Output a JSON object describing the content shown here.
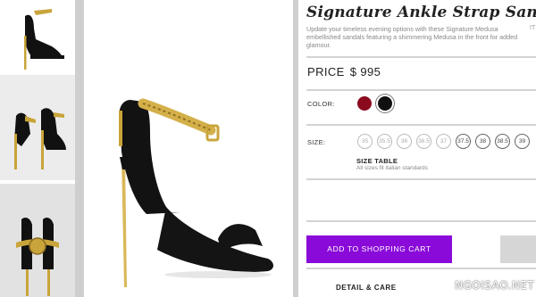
{
  "product": {
    "title": "Signature Ankle Strap Sandals",
    "description": "Update your timeless evening options with these Signature Medusa embellished sandals featuring a shimmering Medusa in the front for added glamour.",
    "description_overflow": "IT",
    "price_label": "PRICE",
    "price_value": "$ 995"
  },
  "color": {
    "label": "COLOR:",
    "swatches": [
      {
        "name": "burgundy",
        "hex": "#8b0a1e"
      },
      {
        "name": "black",
        "hex": "#111111",
        "selected": true
      }
    ]
  },
  "size": {
    "label": "SIZE:",
    "options": [
      {
        "value": "35",
        "available": false
      },
      {
        "value": "35.5",
        "available": false
      },
      {
        "value": "36",
        "available": false
      },
      {
        "value": "36.5",
        "available": false
      },
      {
        "value": "37",
        "available": false
      },
      {
        "value": "37.5",
        "available": true
      },
      {
        "value": "38",
        "available": true
      },
      {
        "value": "38.5",
        "available": true
      },
      {
        "value": "39",
        "available": true
      }
    ],
    "table_label": "SIZE TABLE",
    "table_note": "All sizes fit italian standards"
  },
  "actions": {
    "add_to_cart": "ADD TO SHOPPING CART"
  },
  "sections": {
    "detail_care": "DETAIL & CARE"
  },
  "watermark": "NGOISAO.NET",
  "colors": {
    "accent": "#8a0bd9",
    "gold": "#c9a43a"
  }
}
